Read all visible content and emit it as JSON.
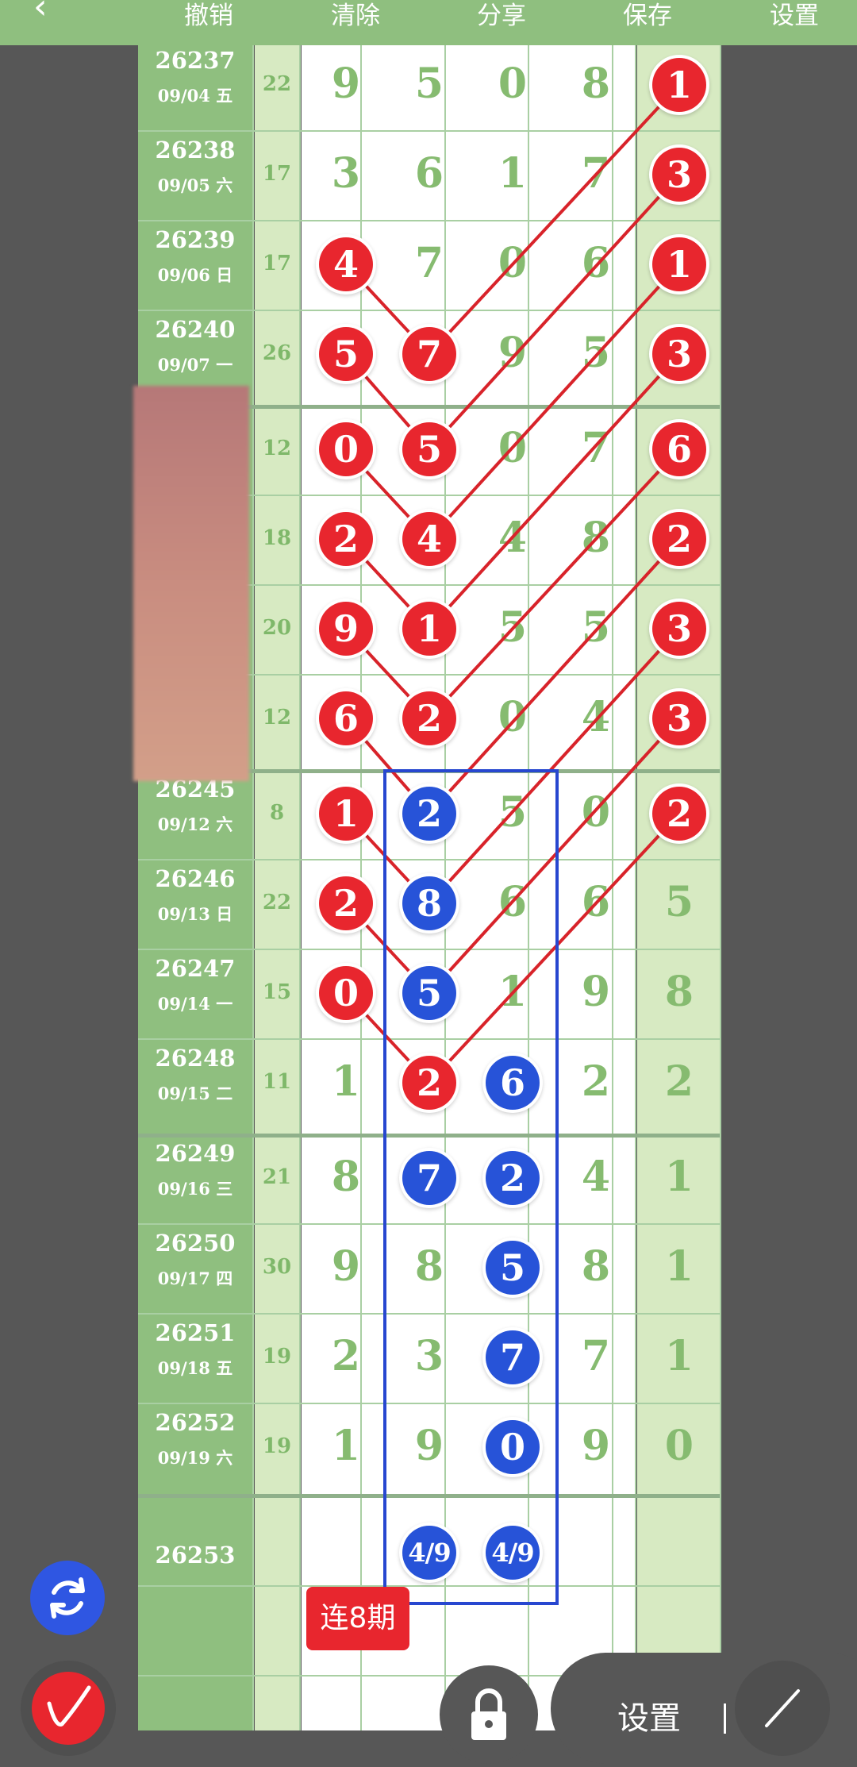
{
  "toolbar": {
    "back_icon": "chevron-left-icon",
    "undo": "撤销",
    "clear": "清除",
    "share": "分享",
    "save": "保存",
    "settings": "设置"
  },
  "rows": [
    {
      "issue": "26237",
      "date": "09/04 五",
      "sum": "22",
      "digits": [
        "9",
        "5",
        "0",
        "8",
        "1"
      ],
      "balls": [
        [
          "",
          "",
          "",
          "",
          "r"
        ]
      ]
    },
    {
      "issue": "26238",
      "date": "09/05 六",
      "sum": "17",
      "digits": [
        "3",
        "6",
        "1",
        "7",
        "3"
      ],
      "balls": [
        [
          "",
          "",
          "",
          "",
          "r"
        ]
      ]
    },
    {
      "issue": "26239",
      "date": "09/06 日",
      "sum": "17",
      "digits": [
        "4",
        "7",
        "0",
        "6",
        "1"
      ],
      "balls": [
        [
          "r",
          "",
          "",
          "",
          "r"
        ]
      ]
    },
    {
      "issue": "26240",
      "date": "09/07 一",
      "sum": "26",
      "digits": [
        "5",
        "7",
        "9",
        "5",
        "3"
      ],
      "balls": [
        [
          "r",
          "r",
          "",
          "",
          "r"
        ]
      ]
    },
    {
      "issue": "",
      "date": "",
      "sum": "12",
      "digits": [
        "0",
        "5",
        "0",
        "7",
        "6"
      ],
      "balls": [
        [
          "r",
          "r",
          "",
          "",
          "r"
        ]
      ]
    },
    {
      "issue": "",
      "date": "",
      "sum": "18",
      "digits": [
        "2",
        "4",
        "4",
        "8",
        "2"
      ],
      "balls": [
        [
          "r",
          "r",
          "",
          "",
          "r"
        ]
      ]
    },
    {
      "issue": "",
      "date": "",
      "sum": "20",
      "digits": [
        "9",
        "1",
        "5",
        "5",
        "3"
      ],
      "balls": [
        [
          "r",
          "r",
          "",
          "",
          "r"
        ]
      ]
    },
    {
      "issue": "",
      "date": "",
      "sum": "12",
      "digits": [
        "6",
        "2",
        "0",
        "4",
        "3"
      ],
      "balls": [
        [
          "r",
          "r",
          "",
          "",
          "r"
        ]
      ]
    },
    {
      "issue": "26245",
      "date": "09/12 六",
      "sum": "8",
      "digits": [
        "1",
        "2",
        "5",
        "0",
        "2"
      ],
      "balls": [
        [
          "r",
          "b",
          "",
          "",
          "r"
        ]
      ]
    },
    {
      "issue": "26246",
      "date": "09/13 日",
      "sum": "22",
      "digits": [
        "2",
        "8",
        "6",
        "6",
        "5"
      ],
      "balls": [
        [
          "r",
          "b",
          "",
          "",
          ""
        ]
      ]
    },
    {
      "issue": "26247",
      "date": "09/14 一",
      "sum": "15",
      "digits": [
        "0",
        "5",
        "1",
        "9",
        "8"
      ],
      "balls": [
        [
          "r",
          "b",
          "",
          "",
          ""
        ]
      ]
    },
    {
      "issue": "26248",
      "date": "09/15 二",
      "sum": "11",
      "digits": [
        "1",
        "2",
        "6",
        "2",
        "2"
      ],
      "balls": [
        [
          "",
          "r",
          "b",
          "",
          ""
        ]
      ]
    },
    {
      "issue": "26249",
      "date": "09/16 三",
      "sum": "21",
      "digits": [
        "8",
        "7",
        "2",
        "4",
        "1"
      ],
      "balls": [
        [
          "",
          "b",
          "b",
          "",
          ""
        ]
      ]
    },
    {
      "issue": "26250",
      "date": "09/17 四",
      "sum": "30",
      "digits": [
        "9",
        "8",
        "5",
        "8",
        "1"
      ],
      "balls": [
        [
          "",
          "",
          "b",
          "",
          ""
        ]
      ]
    },
    {
      "issue": "26251",
      "date": "09/18 五",
      "sum": "19",
      "digits": [
        "2",
        "3",
        "7",
        "7",
        "1"
      ],
      "balls": [
        [
          "",
          "",
          "b",
          "",
          ""
        ]
      ]
    },
    {
      "issue": "26252",
      "date": "09/19 六",
      "sum": "19",
      "digits": [
        "1",
        "9",
        "0",
        "9",
        "0"
      ],
      "balls": [
        [
          "",
          "",
          "b",
          "",
          ""
        ]
      ]
    }
  ],
  "next_row": {
    "issue": "26253",
    "pred_a": "4/9",
    "pred_b": "4/9"
  },
  "streak_label": "连8期",
  "fab": {
    "refresh_icon": "refresh-icon",
    "pen_icon": "pen-icon",
    "lock_icon": "lock-icon",
    "draw_icon": "line-draw-icon"
  },
  "bottom_panel": {
    "settings_label": "设置"
  },
  "colors": {
    "header": "#8fbf7f",
    "issue_col": "#8fbf7f",
    "light_col": "#d7eac2",
    "ball_red": "#e8262e",
    "ball_blue": "#2753d8",
    "digit": "#86bb70",
    "line_red": "#d8232a",
    "box_blue": "#2747d0"
  }
}
